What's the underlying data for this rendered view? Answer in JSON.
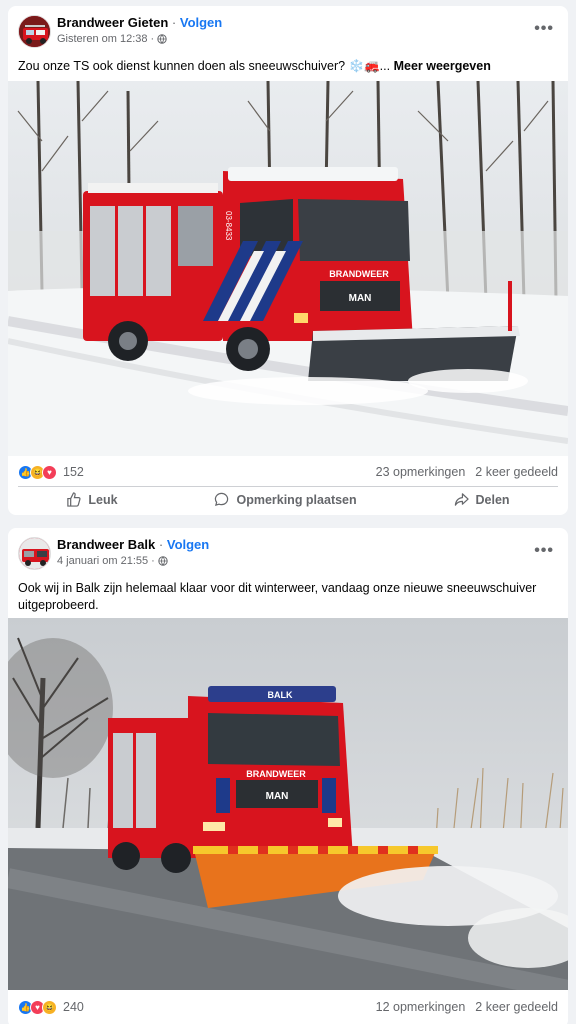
{
  "posts": [
    {
      "author": "Brandweer Gieten",
      "follow_label": "Volgen",
      "separator": "·",
      "timestamp": "Gisteren om 12:38",
      "text": "Zou onze TS ook dienst kunnen doen als sneeuwschuiver? ❄️🚒...",
      "more_label": "Meer weergeven",
      "reaction_count": "152",
      "comments": "23 opmerkingen",
      "shares": "2 keer gedeeld",
      "truck_brand": "BRANDWEER",
      "truck_code": "03-8433",
      "truck_make": "MAN"
    },
    {
      "author": "Brandweer Balk",
      "follow_label": "Volgen",
      "separator": "·",
      "timestamp": "4 januari om 21:55",
      "text": "Ook wij in Balk zijn helemaal klaar voor dit winterweer, vandaag onze nieuwe sneeuwschuiver uitgeprobeerd.",
      "reaction_count": "240",
      "comments": "12 opmerkingen",
      "shares": "2 keer gedeeld",
      "truck_brand": "BRANDWEER",
      "truck_roof": "BALK",
      "truck_make": "MAN"
    }
  ],
  "actions": {
    "like": "Leuk",
    "comment": "Opmerking plaatsen",
    "share": "Delen"
  },
  "icons": {
    "globe": "globe-icon",
    "more": "more-options-icon",
    "like": "thumbs-up-icon",
    "comment": "comment-bubble-icon",
    "share": "share-arrow-icon"
  },
  "colors": {
    "accent": "#1877f2",
    "secondary_text": "#65676b",
    "truck_red": "#d8141e"
  }
}
